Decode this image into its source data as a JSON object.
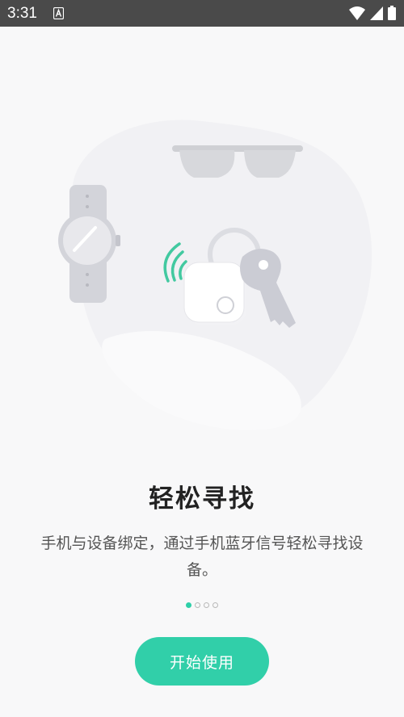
{
  "status_bar": {
    "time": "3:31",
    "notification_icon": "a-badge-icon",
    "wifi_icon": "wifi-icon",
    "signal_icon": "signal-icon",
    "battery_icon": "battery-icon"
  },
  "illustration": {
    "items": [
      "sunglasses-icon",
      "watch-icon",
      "tracker-tag-icon",
      "key-icon",
      "bluetooth-signal-icon"
    ]
  },
  "onboarding": {
    "title": "轻松寻找",
    "description": "手机与设备绑定，通过手机蓝牙信号轻松寻找设备。",
    "page_indicator": {
      "total": 4,
      "current": 1
    },
    "start_button_label": "开始使用"
  },
  "colors": {
    "accent": "#31cfa9",
    "status_bar": "#4a4a4a",
    "title": "#222222",
    "description": "#555555"
  }
}
